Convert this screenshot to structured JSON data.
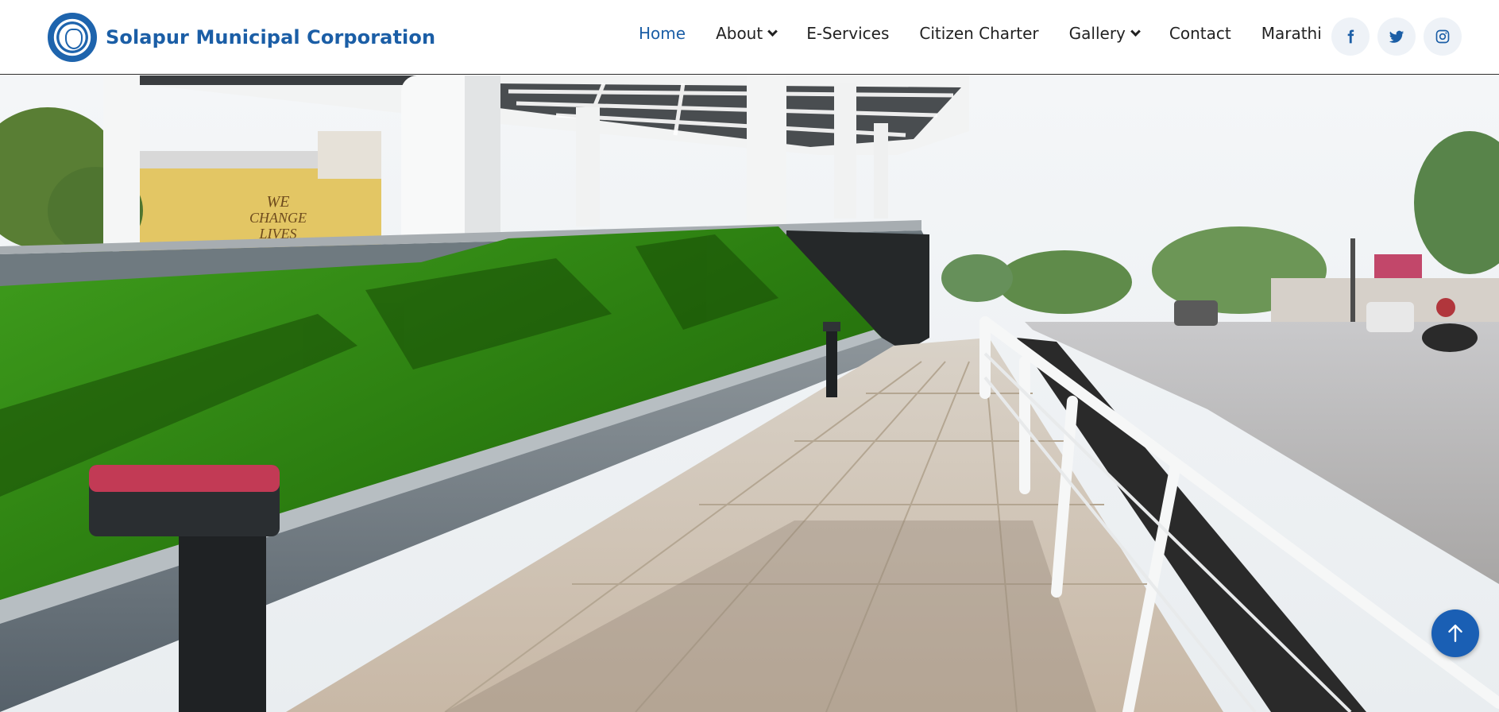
{
  "header": {
    "brand_name": "Solapur Municipal Corporation",
    "logo_icon": "smc-emblem-logo"
  },
  "nav": {
    "items": [
      {
        "label": "Home",
        "active": true,
        "has_dropdown": false
      },
      {
        "label": "About",
        "active": false,
        "has_dropdown": true
      },
      {
        "label": "E-Services",
        "active": false,
        "has_dropdown": false
      },
      {
        "label": "Citizen Charter",
        "active": false,
        "has_dropdown": false
      },
      {
        "label": "Gallery",
        "active": false,
        "has_dropdown": true
      },
      {
        "label": "Contact",
        "active": false,
        "has_dropdown": false
      },
      {
        "label": "Marathi",
        "active": false,
        "has_dropdown": false
      }
    ]
  },
  "socials": [
    {
      "icon": "facebook-icon"
    },
    {
      "icon": "twitter-icon"
    },
    {
      "icon": "instagram-icon"
    }
  ],
  "hero": {
    "image": "smart-city-walkway-photo",
    "building_sign": "WE CHANGE LIVES"
  },
  "back_to_top": {
    "icon": "arrow-up-icon"
  },
  "colors": {
    "brand_blue": "#1b5ea6",
    "active_nav": "#1b5ea6",
    "button_blue": "#1a5fb4",
    "social_bg": "#eef2f7"
  }
}
